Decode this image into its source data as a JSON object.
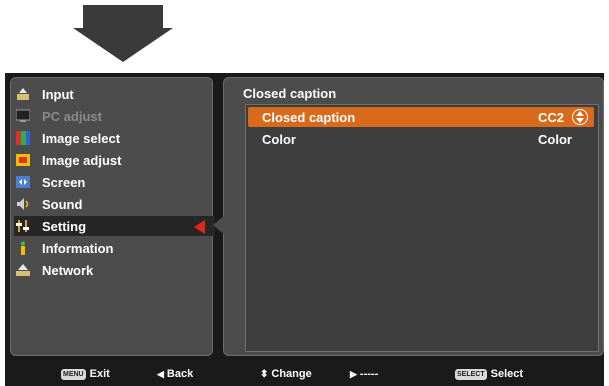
{
  "menu": {
    "items": [
      {
        "label": "Input",
        "icon": "input-icon",
        "state": "normal"
      },
      {
        "label": "PC adjust",
        "icon": "monitor-icon",
        "state": "disabled"
      },
      {
        "label": "Image select",
        "icon": "image-select-icon",
        "state": "normal"
      },
      {
        "label": "Image adjust",
        "icon": "image-adjust-icon",
        "state": "normal"
      },
      {
        "label": "Screen",
        "icon": "screen-icon",
        "state": "normal"
      },
      {
        "label": "Sound",
        "icon": "speaker-icon",
        "state": "normal"
      },
      {
        "label": "Setting",
        "icon": "setting-icon",
        "state": "selected"
      },
      {
        "label": "Information",
        "icon": "info-icon",
        "state": "normal"
      },
      {
        "label": "Network",
        "icon": "network-icon",
        "state": "normal"
      }
    ]
  },
  "panel": {
    "title": "Closed caption",
    "rows": [
      {
        "label": "Closed caption",
        "value": "CC2",
        "active": true
      },
      {
        "label": "Color",
        "value": "Color",
        "active": false
      }
    ]
  },
  "footer": {
    "exit_key": "MENU",
    "exit_label": "Exit",
    "back_label": "Back",
    "change_label": "Change",
    "next_label": "-----",
    "select_key": "SELECT",
    "select_label": "Select"
  },
  "colors": {
    "highlight": "#d96a1c",
    "selection_marker": "#e0281e",
    "panel_bg": "#4c4c4c"
  }
}
